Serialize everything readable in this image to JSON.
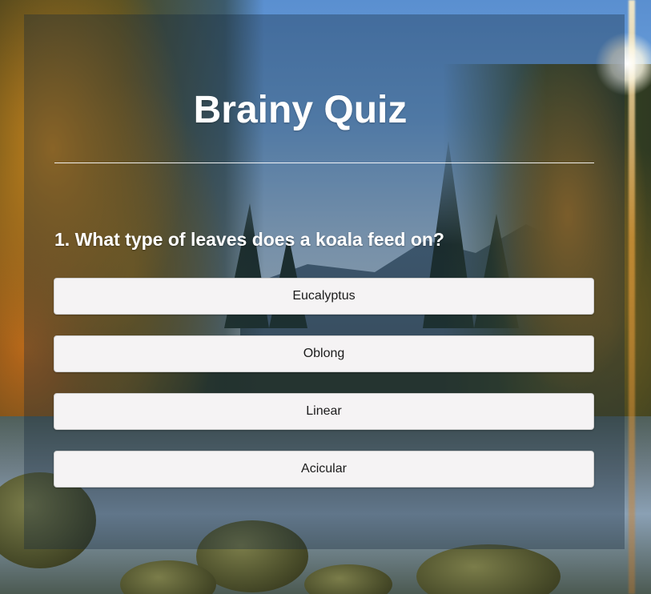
{
  "app": {
    "title": "Brainy Quiz"
  },
  "question": {
    "number": "1.",
    "text": "1. What type of leaves does a koala feed on?"
  },
  "answers": [
    {
      "label": "Eucalyptus"
    },
    {
      "label": "Oblong"
    },
    {
      "label": "Linear"
    },
    {
      "label": "Acicular"
    }
  ],
  "colors": {
    "title_text": "#ffffff",
    "answer_background": "#f5f3f4",
    "answer_text": "#1b1b1b",
    "panel_overlay": "rgba(20, 40, 60, 0.35)"
  }
}
